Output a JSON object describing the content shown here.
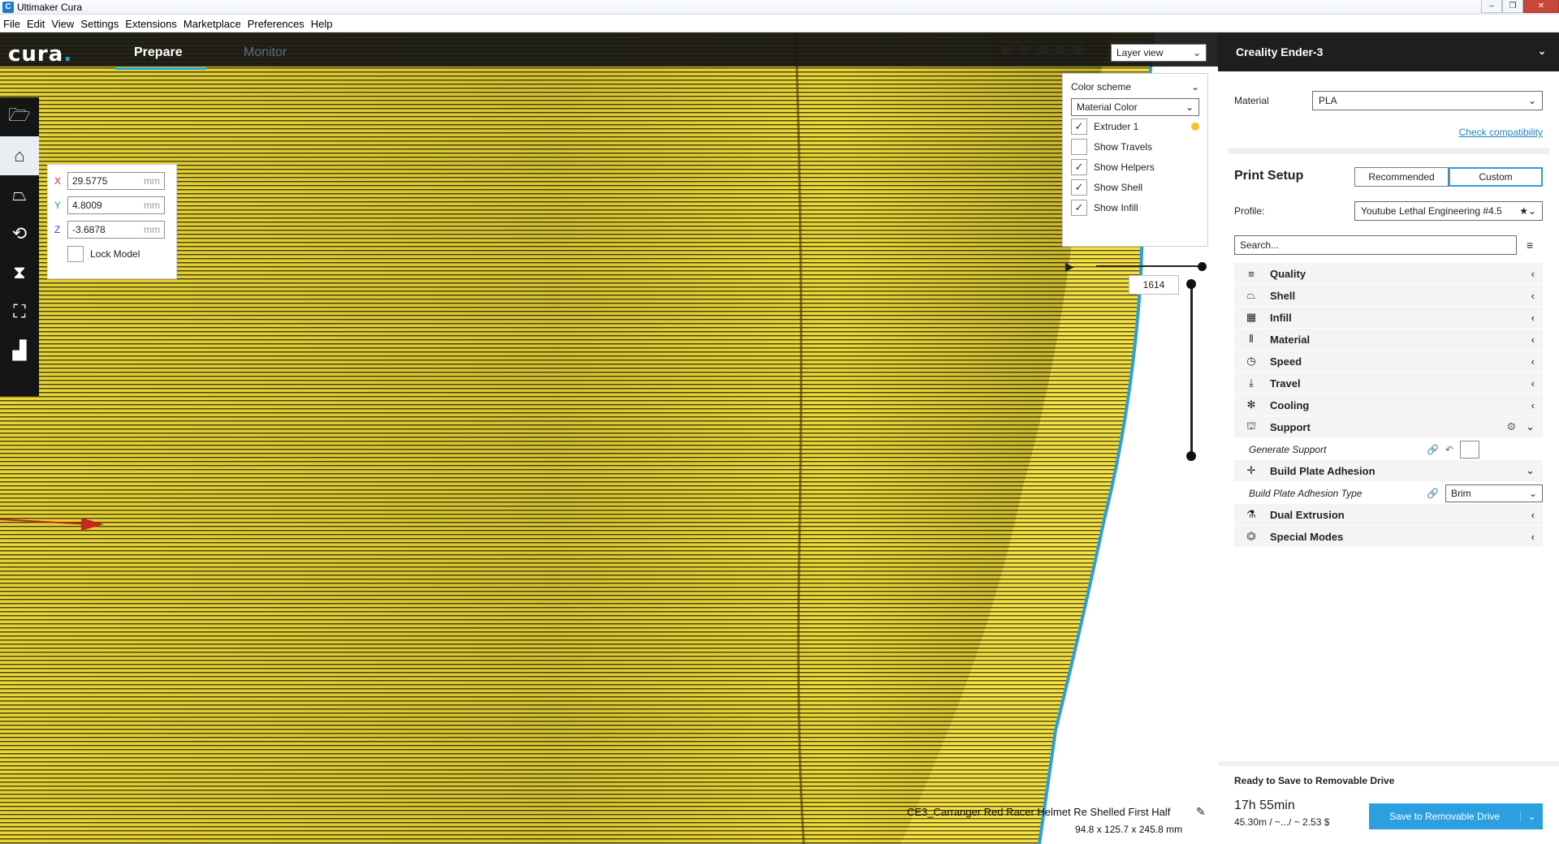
{
  "window": {
    "title": "Ultimaker Cura",
    "app_icon": "C"
  },
  "menu": [
    "File",
    "Edit",
    "View",
    "Settings",
    "Extensions",
    "Marketplace",
    "Preferences",
    "Help"
  ],
  "header": {
    "logo": "cura",
    "tabs": [
      {
        "label": "Prepare",
        "active": true
      },
      {
        "label": "Monitor",
        "active": false
      }
    ],
    "view_select": "Layer view"
  },
  "layer_panel": {
    "color_scheme_label": "Color scheme",
    "color_scheme_value": "Material Color",
    "checks": [
      {
        "label": "Extruder 1",
        "checked": true,
        "dot_color": "#f3c42c"
      },
      {
        "label": "Show Travels",
        "checked": false
      },
      {
        "label": "Show Helpers",
        "checked": true
      },
      {
        "label": "Show Shell",
        "checked": true
      },
      {
        "label": "Show Infill",
        "checked": true
      }
    ],
    "layer_number": "1614"
  },
  "translate": {
    "x_label": "X",
    "x_value": "29.5775",
    "y_label": "Y",
    "y_value": "4.8009",
    "z_label": "Z",
    "z_value": "-3.6878",
    "unit": "mm",
    "lock_label": "Lock Model"
  },
  "model": {
    "name": "CE3_Carranger Red Racer Helmet Re Shelled First Half",
    "size": "94.8 x 125.7 x 245.8 mm"
  },
  "right_panel": {
    "printer": "Creality Ender-3",
    "material_label": "Material",
    "material_value": "PLA",
    "check_compat": "Check compatibility",
    "print_setup_title": "Print Setup",
    "tab_recommended": "Recommended",
    "tab_custom": "Custom",
    "profile_label": "Profile:",
    "profile_value": "Youtube Lethal Engineering #4.5",
    "search_placeholder": "Search...",
    "categories": [
      {
        "label": "Quality",
        "icon": "≡"
      },
      {
        "label": "Shell",
        "icon": "⌂"
      },
      {
        "label": "Infill",
        "icon": "▦"
      },
      {
        "label": "Material",
        "icon": "|||"
      },
      {
        "label": "Speed",
        "icon": "◷"
      },
      {
        "label": "Travel",
        "icon": "⥥"
      },
      {
        "label": "Cooling",
        "icon": "✻"
      },
      {
        "label": "Support",
        "icon": "⚱"
      }
    ],
    "generate_support": "Generate Support",
    "build_plate_adhesion": "Build Plate Adhesion",
    "adhesion_type_label": "Build Plate Adhesion Type",
    "adhesion_type_value": "Brim",
    "dual_extrusion": "Dual Extrusion",
    "special_modes": "Special Modes",
    "ready_text": "Ready to Save to Removable Drive",
    "print_time": "17h 55min",
    "print_stats": "45.30m / ~.../ ~ 2.53 $",
    "save_button": "Save to Removable Drive"
  },
  "colors": {
    "accent": "#2b9fe0",
    "model_yellow": "#f5e13a",
    "dark_header": "#1e1e1e"
  }
}
